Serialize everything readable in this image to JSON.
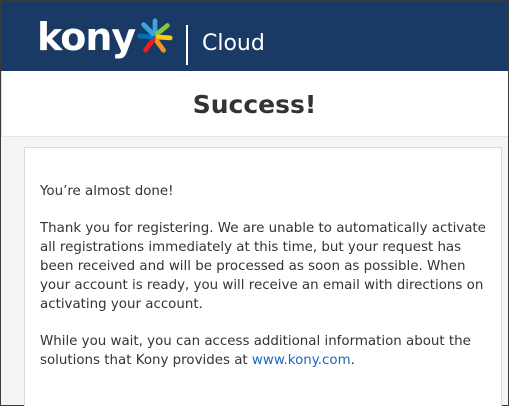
{
  "header": {
    "logo_text": "kony",
    "product_name": "Cloud",
    "logo_colors": [
      "#3aa6dd",
      "#8cc63f",
      "#f7941d",
      "#ed1c24",
      "#0072bc",
      "#ffcb05"
    ],
    "background": "#1a3a66"
  },
  "page": {
    "title": "Success!"
  },
  "message": {
    "greeting": "You’re almost done!",
    "body": "Thank you for registering. We are unable to automatically activate all registrations immediately at this time, but your request has been received and will be processed as soon as possible. When your account is ready, you will receive an email with directions on activating your account.",
    "info_prefix": "While you wait, you can access additional information about the solutions that Kony provides at ",
    "link_text": "www.kony.com",
    "info_suffix": ".",
    "link_color": "#1a66c2"
  }
}
